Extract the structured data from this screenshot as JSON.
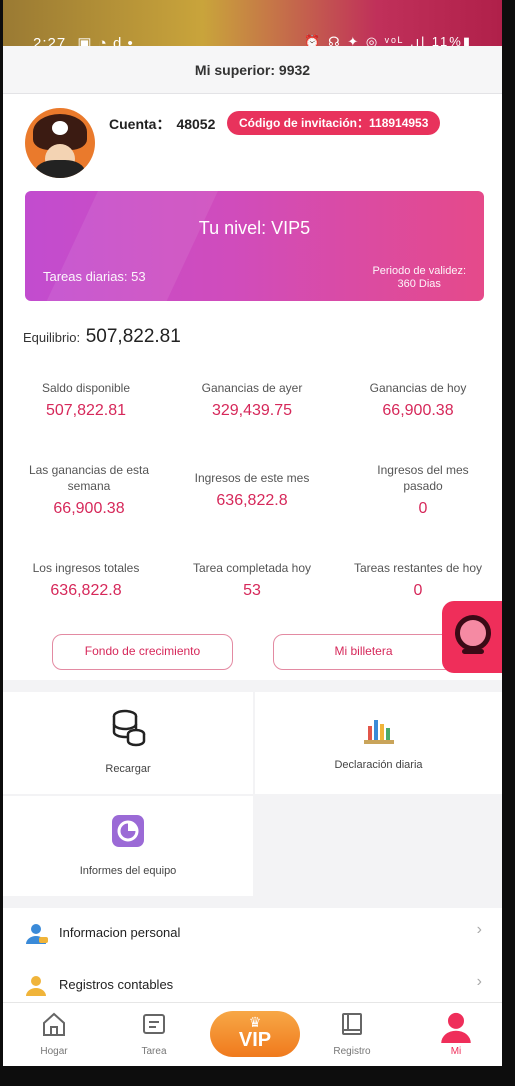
{
  "status_bar": {
    "time": "2:27",
    "left_icons": "▣ ◔ d •",
    "right_icons": "⏰ ☊ ✦ ◎ ᵛᵒᴸ .ıl 11%▮"
  },
  "header": {
    "title": "Mi superior: 9932"
  },
  "profile": {
    "account_label": "Cuenta：",
    "account_number": "48052",
    "invite_label": "Código de invitación：118914953"
  },
  "vip_card": {
    "level": "Tu nivel: VIP5",
    "daily_tasks": "Tareas diarias: 53",
    "validity_label": "Periodo de validez:",
    "validity_value": "360 Dias"
  },
  "balance": {
    "label": "Equilibrio:",
    "value": "507,822.81",
    "stats": [
      {
        "label": "Saldo disponible",
        "value": "507,822.81"
      },
      {
        "label": "Ganancias de ayer",
        "value": "329,439.75"
      },
      {
        "label": "Ganancias de hoy",
        "value": "66,900.38"
      },
      {
        "label": "Las ganancias de esta semana",
        "value": "66,900.38"
      },
      {
        "label": "Ingresos de este mes",
        "value": "636,822.8"
      },
      {
        "label": "Ingresos del mes pasado",
        "value": "0"
      },
      {
        "label": "Los ingresos totales",
        "value": "636,822.8"
      },
      {
        "label": "Tarea completada hoy",
        "value": "53"
      },
      {
        "label": "Tareas restantes de hoy",
        "value": "0"
      }
    ],
    "growth_fund_button": "Fondo de crecimiento",
    "wallet_button": "Mi billetera"
  },
  "shortcuts": [
    {
      "label": "Recargar",
      "icon": "coins-icon"
    },
    {
      "label": "Declaración diaria",
      "icon": "chart-icon"
    },
    {
      "label": "Informes del equipo",
      "icon": "pie-chart-icon"
    }
  ],
  "menu": [
    {
      "label": "Informacion personal",
      "icon": "user-icon"
    },
    {
      "label": "Registros contables",
      "icon": "user-icon"
    }
  ],
  "tabs": [
    {
      "label": "Hogar",
      "icon": "home-icon"
    },
    {
      "label": "Tarea",
      "icon": "task-icon"
    },
    {
      "label": "VIP",
      "icon": "crown-icon"
    },
    {
      "label": "Registro",
      "icon": "book-icon"
    },
    {
      "label": "Mi",
      "icon": "person-icon"
    }
  ],
  "colors": {
    "accent": "#d6285a",
    "invite_bg": "#e8325c",
    "vip_gradient_start": "#c24ccf",
    "vip_gradient_end": "#e54a8a",
    "vip_tab": "#f07a1d"
  }
}
